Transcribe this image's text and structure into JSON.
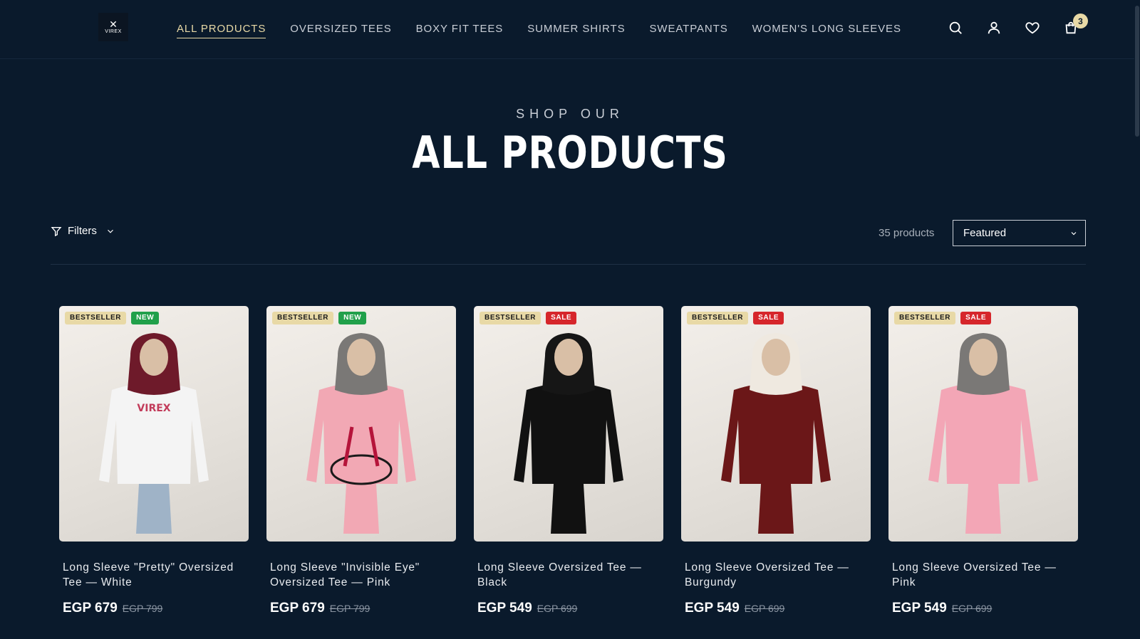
{
  "brand": {
    "logo_text": "VIREX"
  },
  "nav": {
    "items": [
      {
        "label": "ALL PRODUCTS",
        "active": true
      },
      {
        "label": "OVERSIZED TEES",
        "active": false
      },
      {
        "label": "BOXY FIT TEES",
        "active": false
      },
      {
        "label": "SUMMER SHIRTS",
        "active": false
      },
      {
        "label": "SWEATPANTS",
        "active": false
      },
      {
        "label": "WOMEN'S LONG SLEEVES",
        "active": false
      }
    ]
  },
  "header_icons": [
    "search-icon",
    "account-icon",
    "wishlist-heart-icon",
    "cart-bag-icon"
  ],
  "cart": {
    "count": "3"
  },
  "hero": {
    "eyebrow": "SHOP OUR",
    "title": "ALL PRODUCTS"
  },
  "toolbar": {
    "filters_label": "Filters",
    "product_count": "35 products",
    "sort_selected": "Featured"
  },
  "colors": {
    "background": "#0a1a2c",
    "accent_gold": "#e8d9a6",
    "badge_new": "#21a04a",
    "badge_sale": "#d6262b"
  },
  "products": [
    {
      "badges": [
        "BESTSELLER",
        "NEW"
      ],
      "title": "Long Sleeve \"Pretty\" Oversized Tee — White",
      "price": "EGP 679",
      "compare_price": "EGP 799",
      "hijab_color": "#6e1a2a",
      "shirt_color": "#f4f4f4",
      "pants_color": "#9fb3c7",
      "print": "VIREX"
    },
    {
      "badges": [
        "BESTSELLER",
        "NEW"
      ],
      "title": "Long Sleeve \"Invisible Eye\" Oversized Tee — Pink",
      "price": "EGP 679",
      "compare_price": "EGP 799",
      "hijab_color": "#7a7876",
      "shirt_color": "#f2a8b4",
      "pants_color": "#f2a8b4",
      "print": "eye"
    },
    {
      "badges": [
        "BESTSELLER",
        "SALE"
      ],
      "title": "Long Sleeve Oversized Tee — Black",
      "price": "EGP 549",
      "compare_price": "EGP 699",
      "hijab_color": "#161616",
      "shirt_color": "#111111",
      "pants_color": "#111111",
      "print": ""
    },
    {
      "badges": [
        "BESTSELLER",
        "SALE"
      ],
      "title": "Long Sleeve Oversized Tee — Burgundy",
      "price": "EGP 549",
      "compare_price": "EGP 699",
      "hijab_color": "#efe9e0",
      "shirt_color": "#6b1718",
      "pants_color": "#6b1718",
      "print": ""
    },
    {
      "badges": [
        "BESTSELLER",
        "SALE"
      ],
      "title": "Long Sleeve Oversized Tee — Pink",
      "price": "EGP 549",
      "compare_price": "EGP 699",
      "hijab_color": "#7a7876",
      "shirt_color": "#f3a6b6",
      "pants_color": "#f3a6b6",
      "print": ""
    }
  ]
}
